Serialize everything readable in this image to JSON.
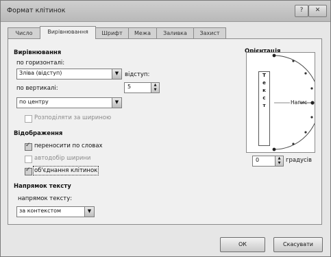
{
  "window": {
    "title": "Формат клітинок",
    "help_label": "?",
    "close_label": "✕"
  },
  "tabs": [
    {
      "label": "Число"
    },
    {
      "label": "Вирівнювання"
    },
    {
      "label": "Шрифт"
    },
    {
      "label": "Межа"
    },
    {
      "label": "Заливка"
    },
    {
      "label": "Захист"
    }
  ],
  "alignment": {
    "section": "Вирівнювання",
    "horizontal_label": "по горизонталі:",
    "horizontal_value": "Зліва (відступ)",
    "indent_label": "відступ:",
    "indent_value": "5",
    "vertical_label": "по вертикалі:",
    "vertical_value": "по центру",
    "distribute_label": "Розподіляти за шириною"
  },
  "display": {
    "section": "Відображення",
    "wrap_label": "переносити по словах",
    "wrap_checked": true,
    "shrink_label": "автодобір ширини",
    "shrink_checked": false,
    "merge_label": "об'єднання клітинок",
    "merge_checked": true
  },
  "direction": {
    "section": "Напрямок тексту",
    "label": "напрямок тексту:",
    "value": "за контекстом"
  },
  "orientation": {
    "section": "Орієнтація",
    "vertical_letters": [
      "Т",
      "е",
      "к",
      "с",
      "т"
    ],
    "inscription_label": "Напис",
    "degrees_value": "0",
    "degrees_label": "градусів"
  },
  "buttons": {
    "ok": "ОК",
    "cancel": "Скасувати"
  }
}
